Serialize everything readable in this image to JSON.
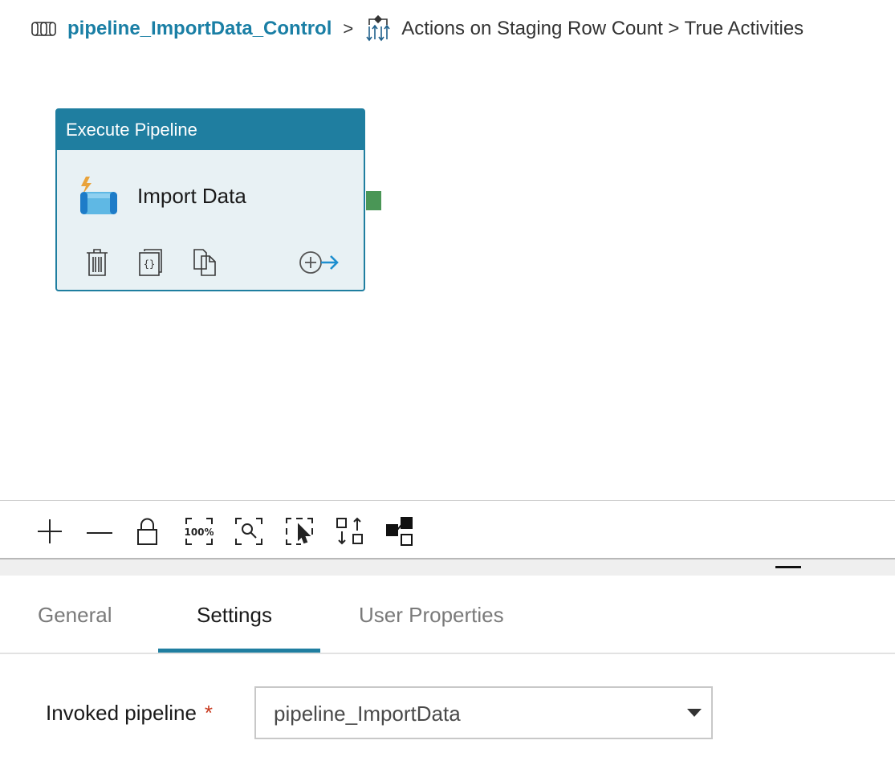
{
  "breadcrumb": {
    "pipeline_icon": "pipeline-icon",
    "pipeline_name": "pipeline_ImportData_Control",
    "separator": ">",
    "activity_icon": "if-condition-icon",
    "activity_path": "Actions on Staging Row Count > True Activities"
  },
  "activity": {
    "type_label": "Execute Pipeline",
    "name": "Import Data",
    "icon": "execute-pipeline-icon",
    "actions": [
      "delete-icon",
      "code-icon",
      "copy-icon",
      "add-output-icon"
    ]
  },
  "toolbar": {
    "tools": [
      "zoom-in-icon",
      "zoom-out-icon",
      "lock-icon",
      "zoom-100-icon",
      "zoom-to-fit-icon",
      "select-icon",
      "auto-align-icon",
      "dependencies-icon"
    ],
    "zoom_100_label": "100%"
  },
  "tabs": [
    {
      "label": "General",
      "active": false
    },
    {
      "label": "Settings",
      "active": true
    },
    {
      "label": "User Properties",
      "active": false
    }
  ],
  "settings": {
    "invoked_pipeline_label": "Invoked pipeline",
    "required_marker": "*",
    "invoked_pipeline_value": "pipeline_ImportData"
  },
  "colors": {
    "accent": "#1f7ea0",
    "link": "#1a7fa5",
    "port_success": "#4a9656",
    "required": "#c8391e"
  }
}
